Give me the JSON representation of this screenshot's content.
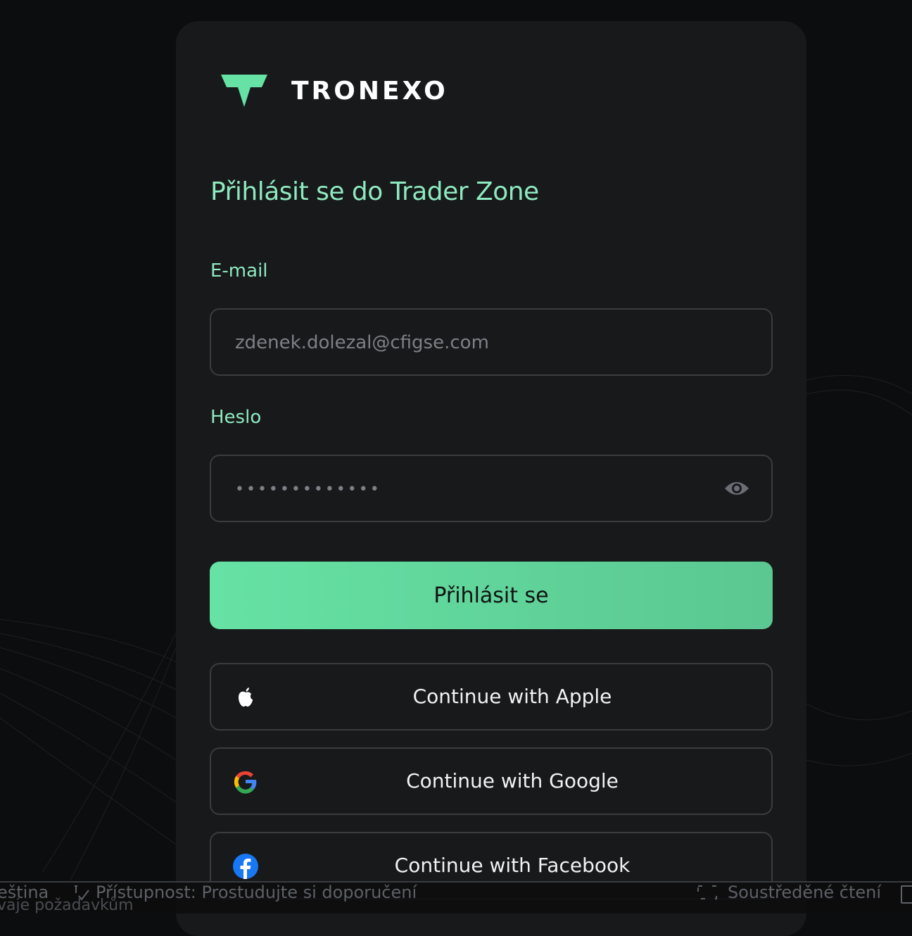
{
  "brand": {
    "name": "TRONEXO",
    "accent": "#66e2a4"
  },
  "login": {
    "title": "Přihlásit se do Trader Zone",
    "email_label": "E-mail",
    "email_value": "zdenek.dolezal@cfigse.com",
    "password_label": "Heslo",
    "password_value": "•••••••••••••",
    "submit_label": "Přihlásit se"
  },
  "oauth": {
    "apple_label": "Continue with Apple",
    "google_label": "Continue with Google",
    "facebook_label": "Continue with Facebook"
  },
  "statusbar": {
    "language": "eština",
    "accessibility": "Přístupnost: Prostudujte si doporučení",
    "accessibility_sub": "vaje požadavkům",
    "focus_mode": "Soustředěné čtení"
  }
}
